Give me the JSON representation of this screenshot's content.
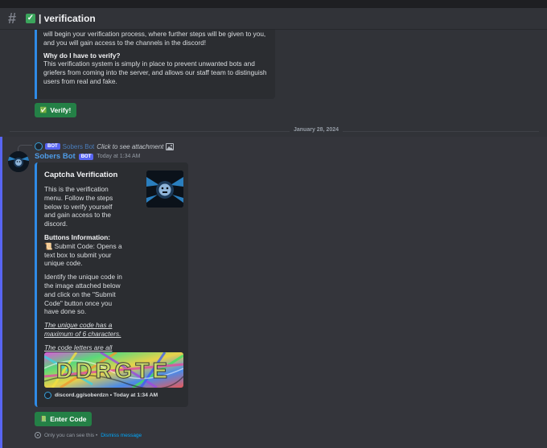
{
  "channel": {
    "name": "verification",
    "emoji": "✓"
  },
  "first_embed": {
    "intro": "will begin your verification process, where further steps will be given to you, and you will gain access to the channels in the discord!",
    "question": "Why do I have to verify?",
    "answer": "This verification system is simply in place to prevent unwanted bots and griefers from coming into the server, and allows our staff team to distinguish users from real and fake."
  },
  "verify_button": {
    "emoji": "✅",
    "label": "Verify!"
  },
  "date_divider": "January 28, 2024",
  "reply": {
    "bot_tag": "BOT",
    "name": "Sobers Bot",
    "text": "Click to see attachment"
  },
  "message": {
    "username": "Sobers Bot",
    "bot_tag": "BOT",
    "timestamp": "Today at 1:34 AM"
  },
  "captcha_embed": {
    "title": "Captcha Verification",
    "description": "This is the verification menu. Follow the steps below to verify yourself and gain access to the discord.",
    "buttons_heading": "Buttons Information:",
    "submit_emoji": "📜",
    "submit_info": "Submit Code: Opens a text box to submit your unique code.",
    "instructions": "Identify the unique code in the image attached below and click on the \"Submit Code\" button once you have done so.",
    "note1": "The unique code has a maximum of 6 characters.",
    "note2": "The code letters are all UPPERCASE",
    "captcha_text": "DDRGTE",
    "footer_text": "discord.gg/soberdzn • Today at 1:34 AM"
  },
  "enter_button": {
    "emoji": "📗",
    "label": "Enter Code"
  },
  "ephemeral": {
    "text": "Only you can see this •",
    "dismiss": "Dismiss message"
  },
  "colors": {
    "accent": "#5865f2",
    "green": "#248046",
    "embed_border": "#2f8be6",
    "link": "#00a8fc"
  }
}
